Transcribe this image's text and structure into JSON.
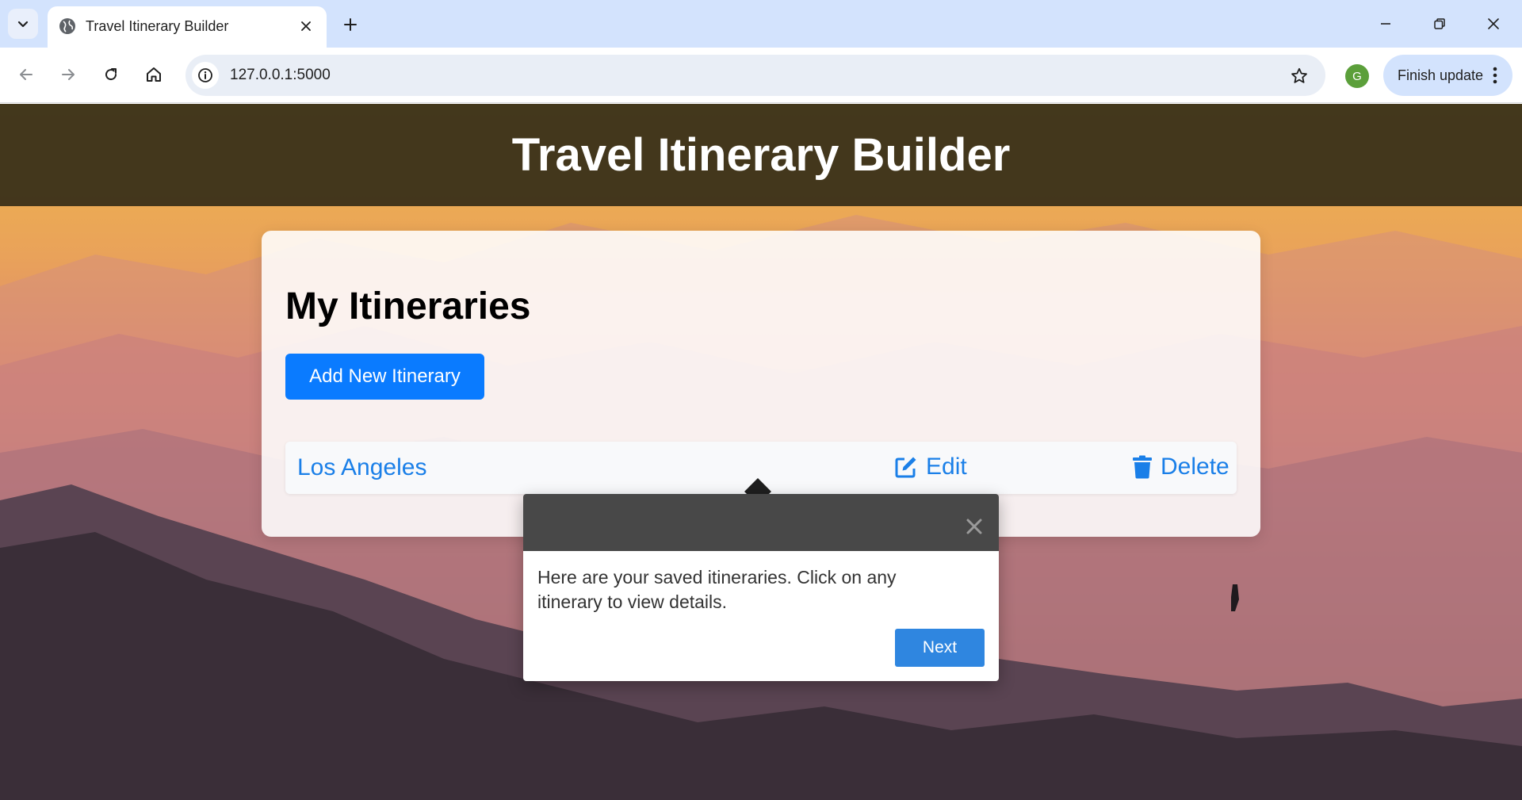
{
  "browser": {
    "tab": {
      "title": "Travel Itinerary Builder",
      "favicon": "globe-icon"
    },
    "address_bar": {
      "url": "127.0.0.1:5000",
      "site_info_icon": "info-icon"
    },
    "profile": {
      "initial": "G",
      "color": "#5b9f3a"
    },
    "update_button": {
      "label": "Finish update"
    }
  },
  "app": {
    "title": "Travel Itinerary Builder",
    "header_color": "#342c18"
  },
  "main": {
    "section_title": "My Itineraries",
    "add_button_label": "Add New Itinerary",
    "accent_color": "#0a7bff",
    "itineraries": [
      {
        "name": "Los Angeles",
        "edit_label": "Edit",
        "delete_label": "Delete"
      }
    ]
  },
  "tour": {
    "text": "Here are your saved itineraries. Click on any itinerary to view details.",
    "next_label": "Next",
    "close_icon": "close-icon"
  }
}
